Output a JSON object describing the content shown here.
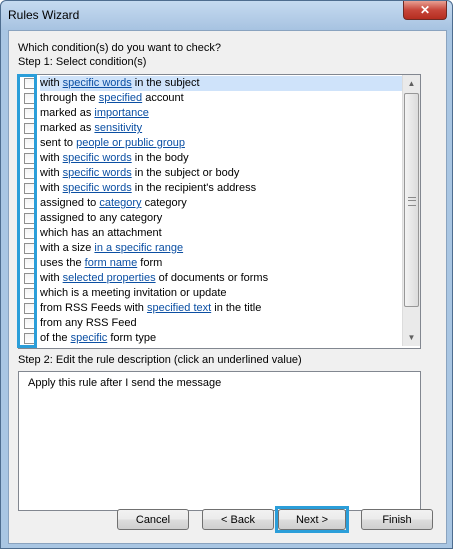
{
  "window": {
    "title": "Rules Wizard",
    "close_glyph": "✕"
  },
  "question": "Which condition(s) do you want to check?",
  "step1_label": "Step 1: Select condition(s)",
  "conditions": [
    {
      "pre": "with ",
      "link": "specific words",
      "post": " in the subject",
      "selected": true
    },
    {
      "pre": "through the ",
      "link": "specified",
      "post": " account"
    },
    {
      "pre": "marked as ",
      "link": "importance",
      "post": ""
    },
    {
      "pre": "marked as ",
      "link": "sensitivity",
      "post": ""
    },
    {
      "pre": "sent to ",
      "link": "people or public group",
      "post": ""
    },
    {
      "pre": "with ",
      "link": "specific words",
      "post": " in the body"
    },
    {
      "pre": "with ",
      "link": "specific words",
      "post": " in the subject or body"
    },
    {
      "pre": "with ",
      "link": "specific words",
      "post": " in the recipient's address"
    },
    {
      "pre": "assigned to ",
      "link": "category",
      "post": " category"
    },
    {
      "pre": "assigned to any category",
      "link": "",
      "post": ""
    },
    {
      "pre": "which has an attachment",
      "link": "",
      "post": ""
    },
    {
      "pre": "with a size ",
      "link": "in a specific range",
      "post": ""
    },
    {
      "pre": "uses the ",
      "link": "form name",
      "post": " form"
    },
    {
      "pre": "with ",
      "link": "selected properties",
      "post": " of documents or forms"
    },
    {
      "pre": "which is a meeting invitation or update",
      "link": "",
      "post": ""
    },
    {
      "pre": "from RSS Feeds with ",
      "link": "specified text",
      "post": " in the title"
    },
    {
      "pre": "from any RSS Feed",
      "link": "",
      "post": ""
    },
    {
      "pre": "of the ",
      "link": "specific",
      "post": " form type"
    }
  ],
  "step2_label": "Step 2: Edit the rule description (click an underlined value)",
  "description": "Apply this rule after I send the message",
  "buttons": {
    "cancel": "Cancel",
    "back": "< Back",
    "next": "Next >",
    "finish": "Finish"
  },
  "colors": {
    "link": "#0b4fa3",
    "highlight": "#2b9ed9",
    "selection": "#cfe3fa"
  }
}
